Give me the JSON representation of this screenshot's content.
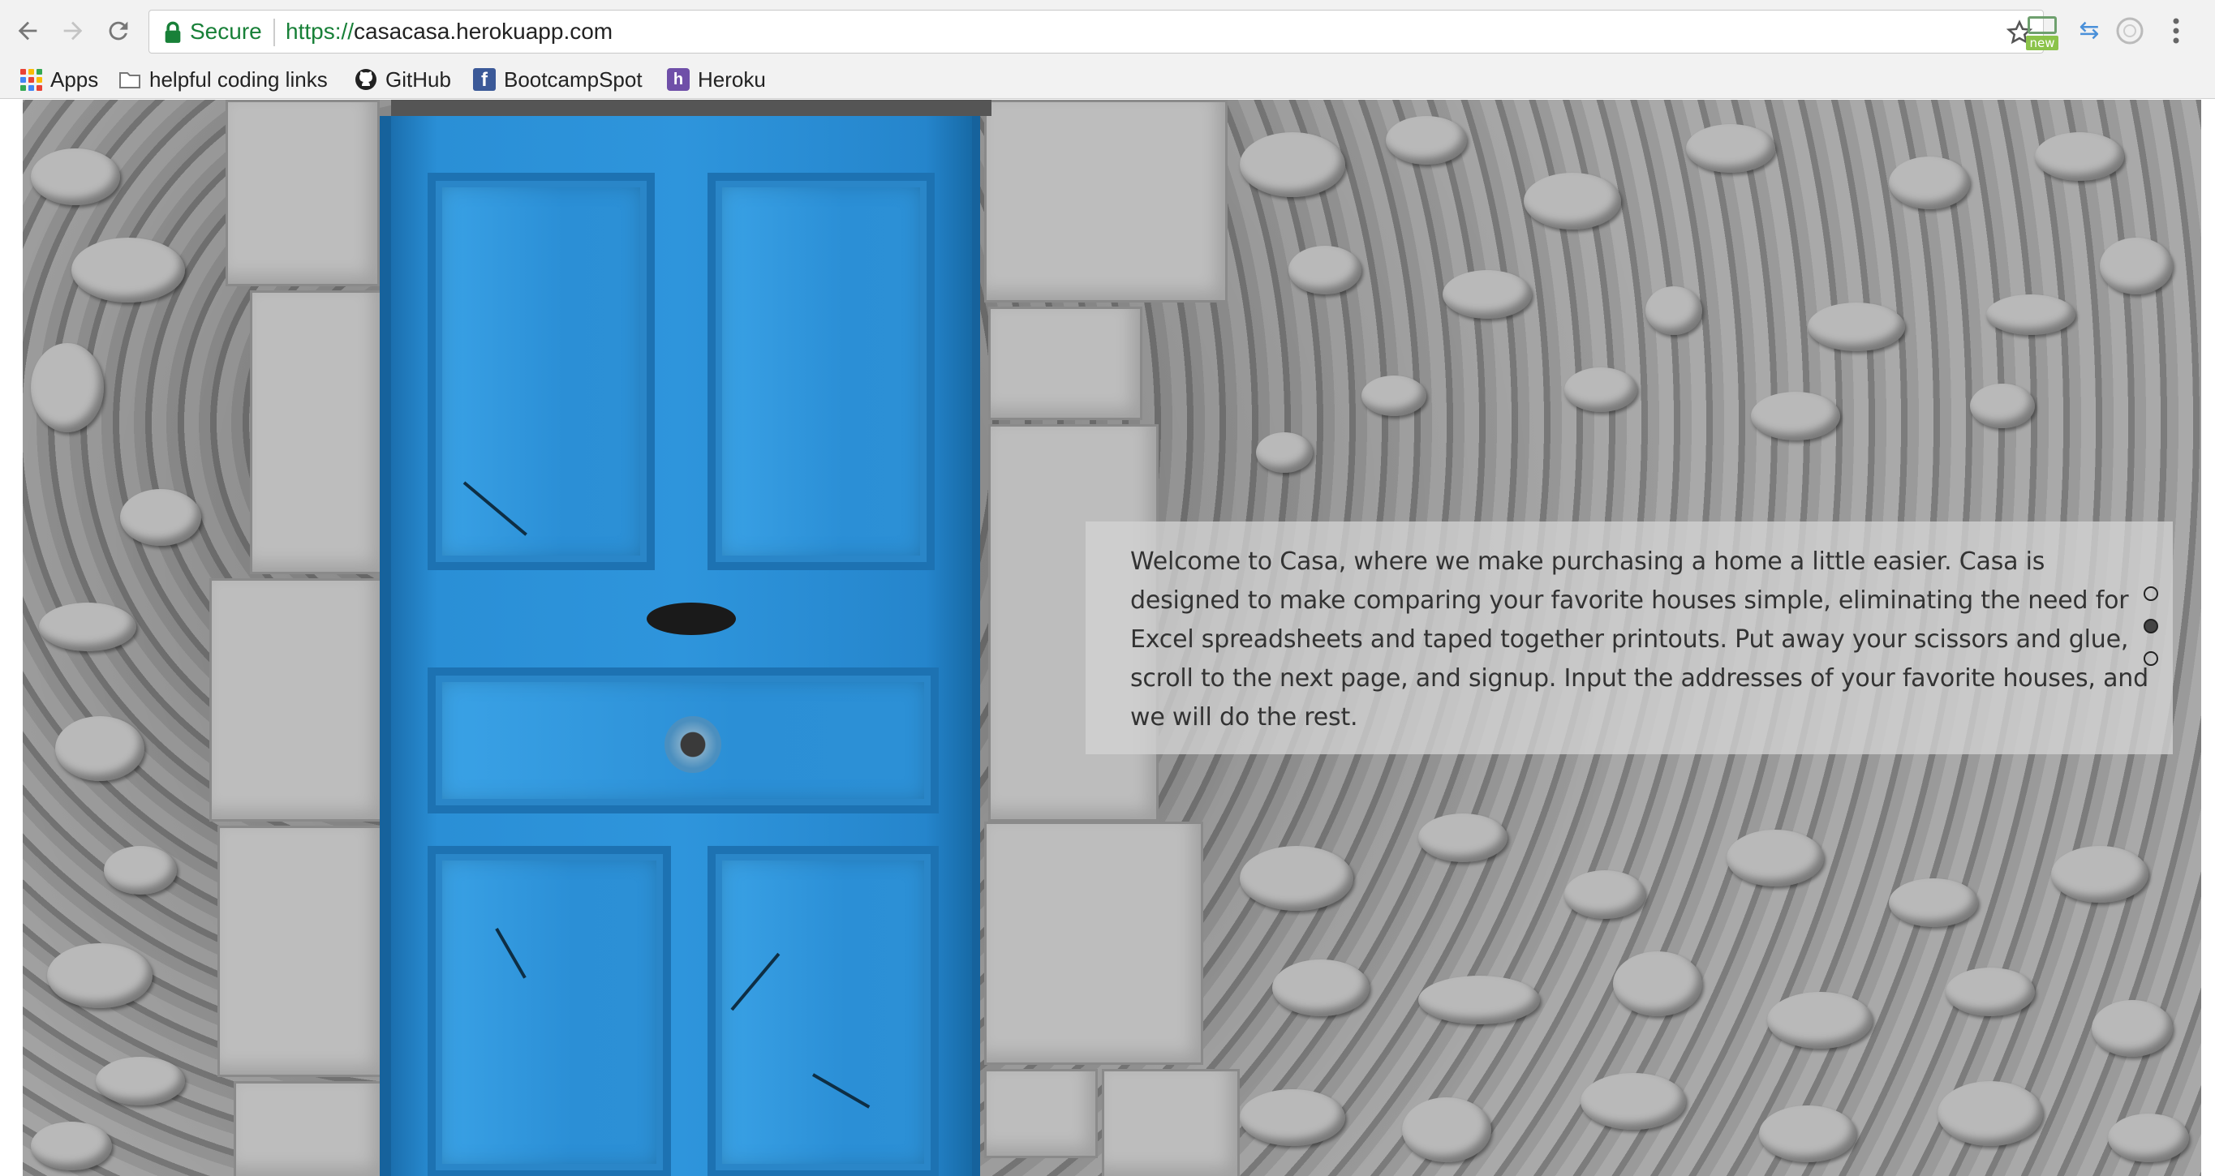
{
  "browser": {
    "nav": {
      "back_icon": "arrow-left-icon",
      "forward_icon": "arrow-right-icon",
      "reload_icon": "reload-icon"
    },
    "secure_label": "Secure",
    "url_scheme": "https://",
    "url_host": "casacasa.herokuapp.com",
    "extension_badge": "new"
  },
  "bookmarks": [
    {
      "label": "Apps",
      "icon": "apps-grid-icon"
    },
    {
      "label": "helpful coding links",
      "icon": "folder-icon"
    },
    {
      "label": "GitHub",
      "icon": "github-icon"
    },
    {
      "label": "BootcampSpot",
      "icon": "facebook-icon"
    },
    {
      "label": "Heroku",
      "icon": "heroku-icon"
    }
  ],
  "page": {
    "welcome_text": "Welcome to Casa, where we make purchasing a home a little easier. Casa is designed to make comparing your favorite houses simple, eliminating the need for Excel spreadsheets and taped together printouts. Put away your scissors and glue, scroll to the next page, and signup. Input the addresses of your favorite houses, and we will do the rest.",
    "pagination": {
      "count": 3,
      "active_index": 1
    }
  },
  "colors": {
    "secure_green": "#188038",
    "door_blue": "#2e95dc",
    "panel_gray": "#d2d2d2"
  }
}
